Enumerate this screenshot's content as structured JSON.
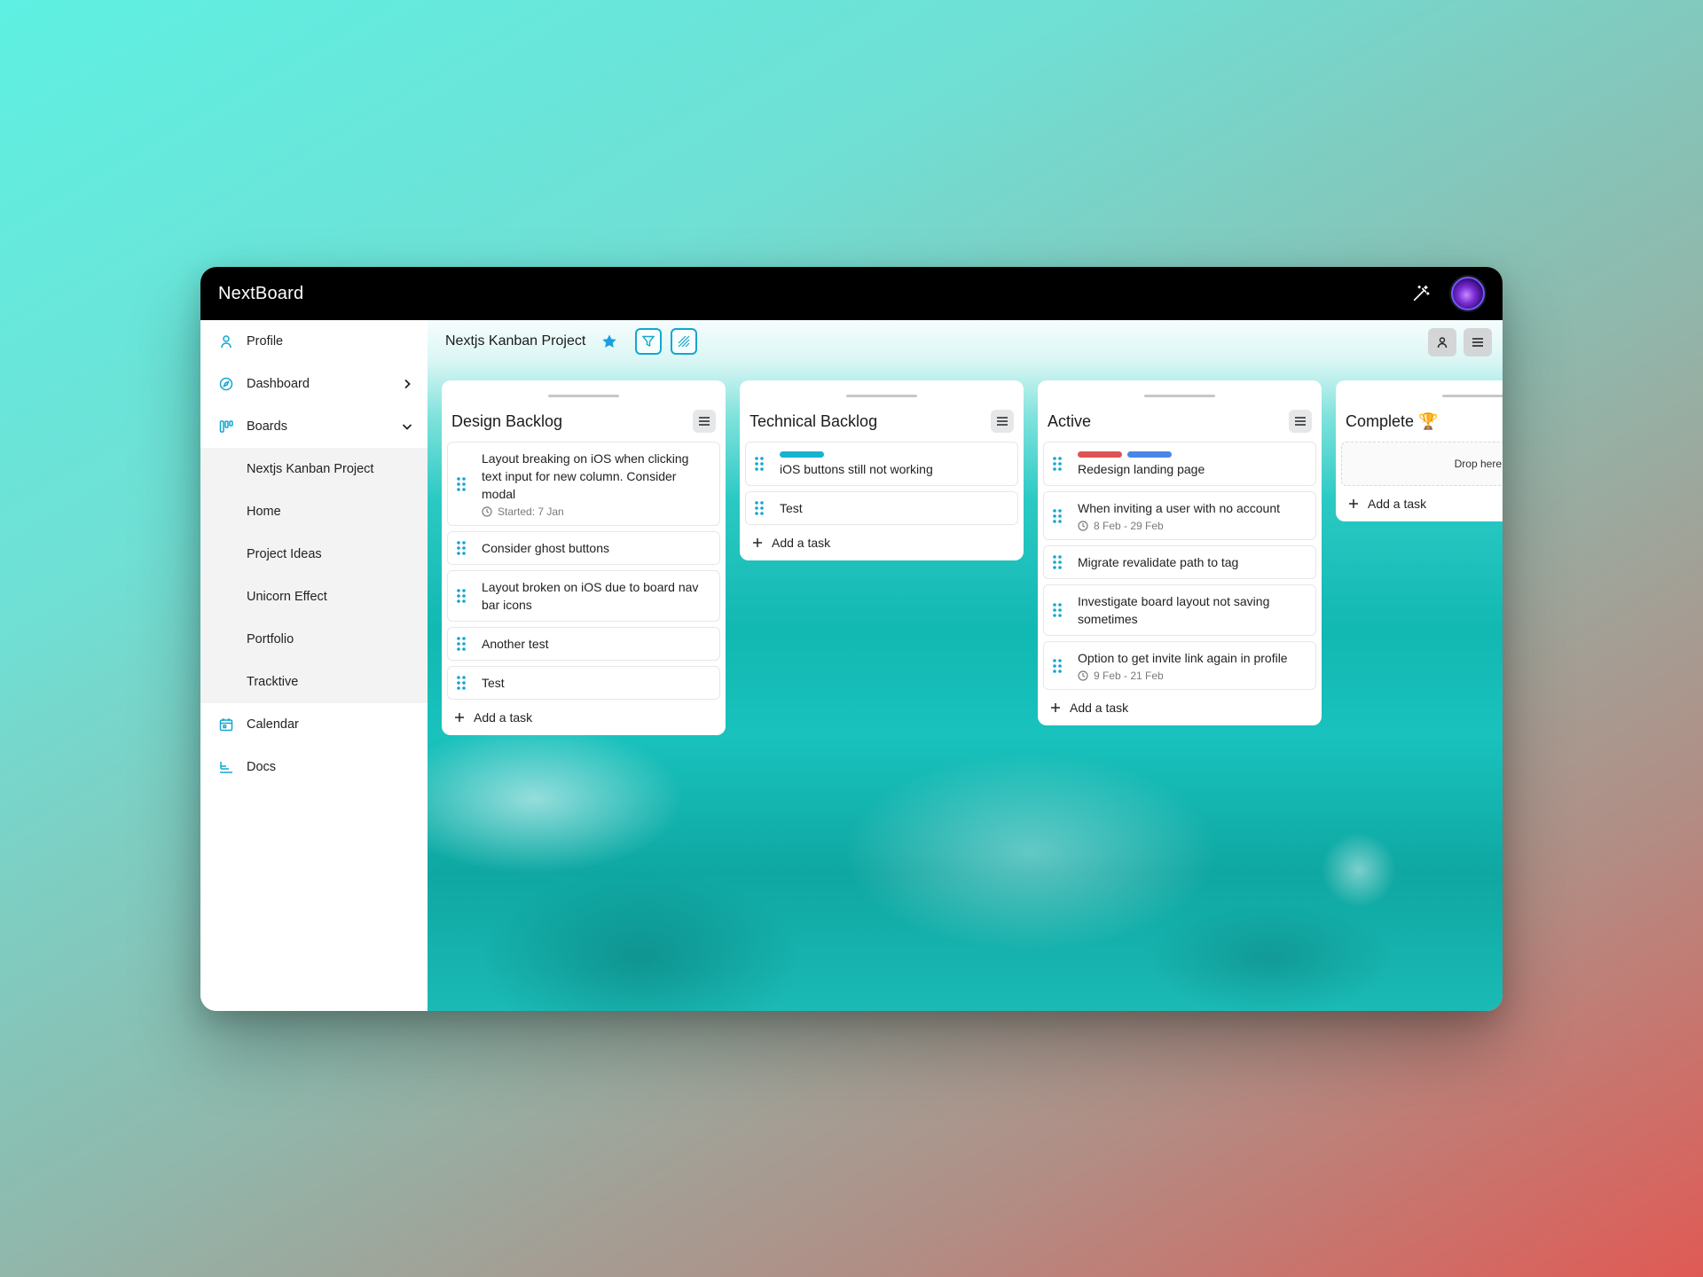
{
  "app": {
    "brand": "NextBoard"
  },
  "sidebar": {
    "items": [
      {
        "label": "Profile",
        "icon": "user-icon"
      },
      {
        "label": "Dashboard",
        "icon": "compass-icon"
      },
      {
        "label": "Boards",
        "icon": "boards-icon"
      }
    ],
    "boards": [
      "Nextjs Kanban Project",
      "Home",
      "Project Ideas",
      "Unicorn Effect",
      "Portfolio",
      "Tracktive"
    ],
    "bottom": [
      {
        "label": "Calendar",
        "icon": "calendar-icon"
      },
      {
        "label": "Docs",
        "icon": "docs-icon"
      }
    ]
  },
  "board": {
    "title": "Nextjs Kanban Project"
  },
  "columns": [
    {
      "title": "Design Backlog",
      "cards": [
        {
          "text": "Layout breaking on iOS when clicking text input for new column. Consider modal",
          "meta": "Started: 7 Jan"
        },
        {
          "text": "Consider ghost buttons"
        },
        {
          "text": "Layout broken on iOS due to board nav bar icons"
        },
        {
          "text": "Another test"
        },
        {
          "text": "Test"
        }
      ],
      "add_label": "Add a task"
    },
    {
      "title": "Technical Backlog",
      "cards": [
        {
          "text": "iOS buttons still not working",
          "labels": [
            "#17b3cf"
          ]
        },
        {
          "text": "Test"
        }
      ],
      "add_label": "Add a task"
    },
    {
      "title": "Active",
      "cards": [
        {
          "text": "Redesign landing page",
          "labels": [
            "#e05252",
            "#4a86e8"
          ]
        },
        {
          "text": "When inviting a user with no account",
          "meta": "8 Feb - 29 Feb"
        },
        {
          "text": "Migrate revalidate path to tag"
        },
        {
          "text": "Investigate board layout not saving sometimes"
        },
        {
          "text": "Option to get invite link again in profile",
          "meta": "9 Feb - 21 Feb"
        }
      ],
      "add_label": "Add a task"
    },
    {
      "title": "Complete 🏆",
      "drop_label": "Drop here",
      "add_label": "Add a task"
    }
  ],
  "colors": {
    "accent": "#14a6d1",
    "topbar": "#000000"
  }
}
